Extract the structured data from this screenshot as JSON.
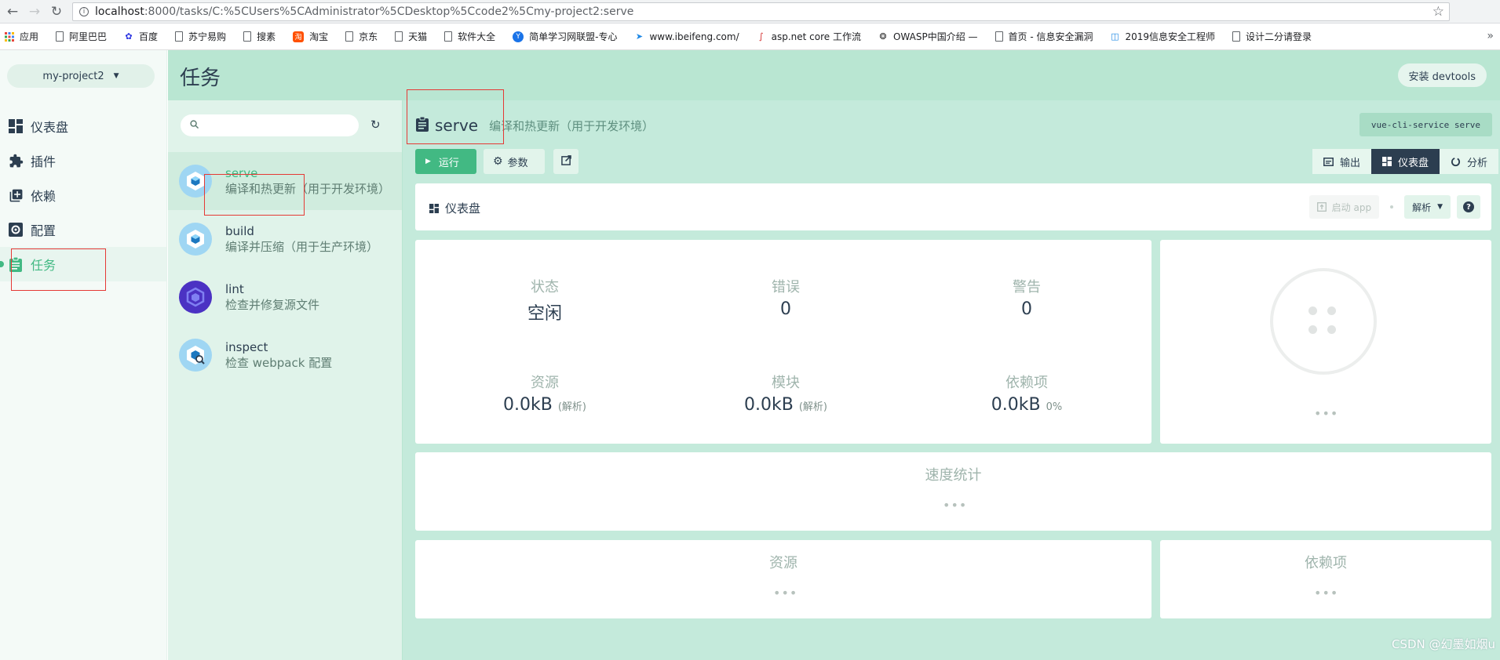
{
  "browser": {
    "url_host": "localhost",
    "url_path": ":8000/tasks/C:%5CUsers%5CAdministrator%5CDesktop%5Ccode2%5Cmy-project2:serve",
    "bookmarks": [
      {
        "label": "应用",
        "icon": "apps-grid-icon"
      },
      {
        "label": "阿里巴巴",
        "icon": "page-icon"
      },
      {
        "label": "百度",
        "icon": "baidu-paw-icon"
      },
      {
        "label": "苏宁易购",
        "icon": "page-icon"
      },
      {
        "label": "搜素",
        "icon": "page-icon"
      },
      {
        "label": "淘宝",
        "icon": "taobao-icon"
      },
      {
        "label": "京东",
        "icon": "page-icon"
      },
      {
        "label": "天猫",
        "icon": "page-icon"
      },
      {
        "label": "软件大全",
        "icon": "page-icon"
      },
      {
        "label": "简单学习网联盟-专心",
        "icon": "shield-icon"
      },
      {
        "label": "www.ibeifeng.com/",
        "icon": "bird-icon"
      },
      {
        "label": "asp.net core 工作流",
        "icon": "swirl-icon"
      },
      {
        "label": "OWASP中国介绍 —",
        "icon": "owasp-icon"
      },
      {
        "label": "首页 - 信息安全漏洞",
        "icon": "page-icon"
      },
      {
        "label": "2019信息安全工程师",
        "icon": "tv-icon"
      },
      {
        "label": "设计二分请登录",
        "icon": "page-icon"
      }
    ]
  },
  "sidebar": {
    "project": "my-project2",
    "items": [
      {
        "label": "仪表盘",
        "icon": "dashboard-icon"
      },
      {
        "label": "插件",
        "icon": "puzzle-icon"
      },
      {
        "label": "依赖",
        "icon": "library-icon"
      },
      {
        "label": "配置",
        "icon": "settings-icon"
      },
      {
        "label": "任务",
        "icon": "clipboard-icon"
      }
    ]
  },
  "header": {
    "title": "任务",
    "devtools": "安装 devtools"
  },
  "tasks": {
    "search_placeholder": "",
    "items": [
      {
        "name": "serve",
        "desc": "编译和热更新（用于开发环境）"
      },
      {
        "name": "build",
        "desc": "编译并压缩（用于生产环境）"
      },
      {
        "name": "lint",
        "desc": "检查并修复源文件"
      },
      {
        "name": "inspect",
        "desc": "检查 webpack 配置"
      }
    ]
  },
  "main": {
    "task_name": "serve",
    "task_desc": "编译和热更新（用于开发环境）",
    "command": "vue-cli-service serve",
    "run": "运行",
    "params": "参数",
    "tabs": [
      "输出",
      "仪表盘",
      "分析"
    ],
    "dashboard_title": "仪表盘",
    "start_app": "启动 app",
    "analyze": "解析",
    "help": "?",
    "stats": {
      "status_label": "状态",
      "status_value": "空闲",
      "errors_label": "错误",
      "errors_value": "0",
      "warnings_label": "警告",
      "warnings_value": "0",
      "assets_label": "资源",
      "assets_value": "0.0kB",
      "assets_note": "(解析)",
      "modules_label": "模块",
      "modules_value": "0.0kB",
      "modules_note": "(解析)",
      "deps_label": "依赖项",
      "deps_value": "0.0kB",
      "deps_note": "0%"
    },
    "ellipsis": "•••",
    "speed_title": "速度统计",
    "assets_title": "资源",
    "deps_title": "依赖项"
  },
  "watermark": "CSDN @幻墨如烟u",
  "colors": {
    "accent": "#42b983",
    "dark": "#2c3e50",
    "highlight": "#e53935"
  }
}
